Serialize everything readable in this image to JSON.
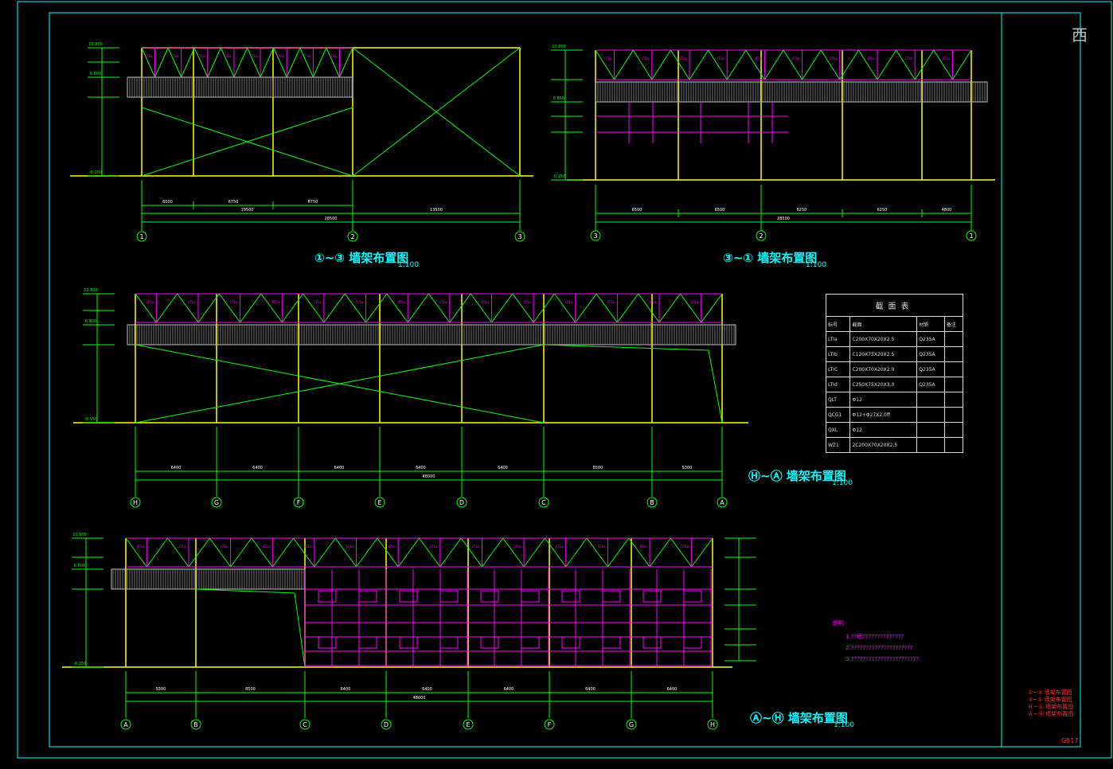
{
  "ui": {
    "corner_char": "西"
  },
  "colors": {
    "frame": "#00ffff",
    "column": "#ffff00",
    "ground": "#ffff00",
    "brace": "#00ff00",
    "purlin": "#ff00ff",
    "cladding": "#bbbbbb",
    "dim": "#00ff00"
  },
  "views": {
    "v1": {
      "title": "①~③ 墙架布置图",
      "scale": "1:100",
      "dims_top": [
        "6000",
        "6750",
        "6750"
      ],
      "dims_mid": [
        "19500",
        "13500"
      ],
      "dim_total": "28500",
      "axes": [
        "1",
        "2",
        "3"
      ],
      "elev_labels": [
        "10.800",
        "6.800",
        "-0.150"
      ]
    },
    "v2": {
      "title": "③~① 墙架布置图",
      "scale": "1:100",
      "dims_top": [
        "6500",
        "6500",
        "6250",
        "6250",
        "4800"
      ],
      "dim_total": "28500",
      "axes": [
        "3",
        "2",
        "1"
      ],
      "elev_labels": [
        "10.800",
        "6.800",
        "-0.150"
      ]
    },
    "v3": {
      "title": "Ⓗ~Ⓐ 墙架布置图",
      "scale": "1:100",
      "dims_top": [
        "6400",
        "6400",
        "6400",
        "6400",
        "6400",
        "8500",
        "5300"
      ],
      "dim_total": "48000",
      "axes": [
        "H",
        "G",
        "F",
        "E",
        "D",
        "C",
        "B",
        "A"
      ],
      "elev_labels": [
        "10.800",
        "6.800",
        "-0.150"
      ]
    },
    "v4": {
      "title": "Ⓐ~Ⓗ 墙架布置图",
      "scale": "1:100",
      "dims_top": [
        "5300",
        "8500",
        "6400",
        "6400",
        "6400",
        "6400",
        "6400"
      ],
      "dim_total": "48000",
      "axes": [
        "A",
        "B",
        "C",
        "D",
        "E",
        "F",
        "G",
        "H"
      ],
      "elev_labels": [
        "10.800",
        "6.800",
        "-0.150"
      ]
    }
  },
  "section_table": {
    "caption": "截面表",
    "headers": [
      "标号",
      "截面",
      "材质",
      "备注"
    ],
    "rows": [
      [
        "LTIa",
        "C200X70X20X2.5",
        "Q235A",
        ""
      ],
      [
        "LTIb",
        "C120X75X20X2.5",
        "Q235A",
        ""
      ],
      [
        "LTIC",
        "C200X70X20X2.0",
        "Q235A",
        ""
      ],
      [
        "LTId",
        "C250X75X20X3.0",
        "Q235A",
        ""
      ],
      [
        "QLT",
        "Φ12",
        "",
        ""
      ],
      [
        "QCG1",
        "Φ12+Φ27X2.0ff",
        "",
        ""
      ],
      [
        "QXL",
        "Φ12",
        "",
        ""
      ],
      [
        "WZ1",
        "2C200X70X20X2.5",
        "",
        ""
      ]
    ]
  },
  "notes": {
    "heading": "说明:",
    "lines": [
      "1.??墙??????????????",
      "2.?????????????????????",
      "3.???????????????????????"
    ]
  },
  "legend": [
    "①~③ 墙架布置图",
    "③~① 墙架布置图",
    "Ⓗ~Ⓐ 墙架布置图",
    "Ⓐ~Ⓗ 墙架布置图"
  ],
  "drawing_no": "G517"
}
